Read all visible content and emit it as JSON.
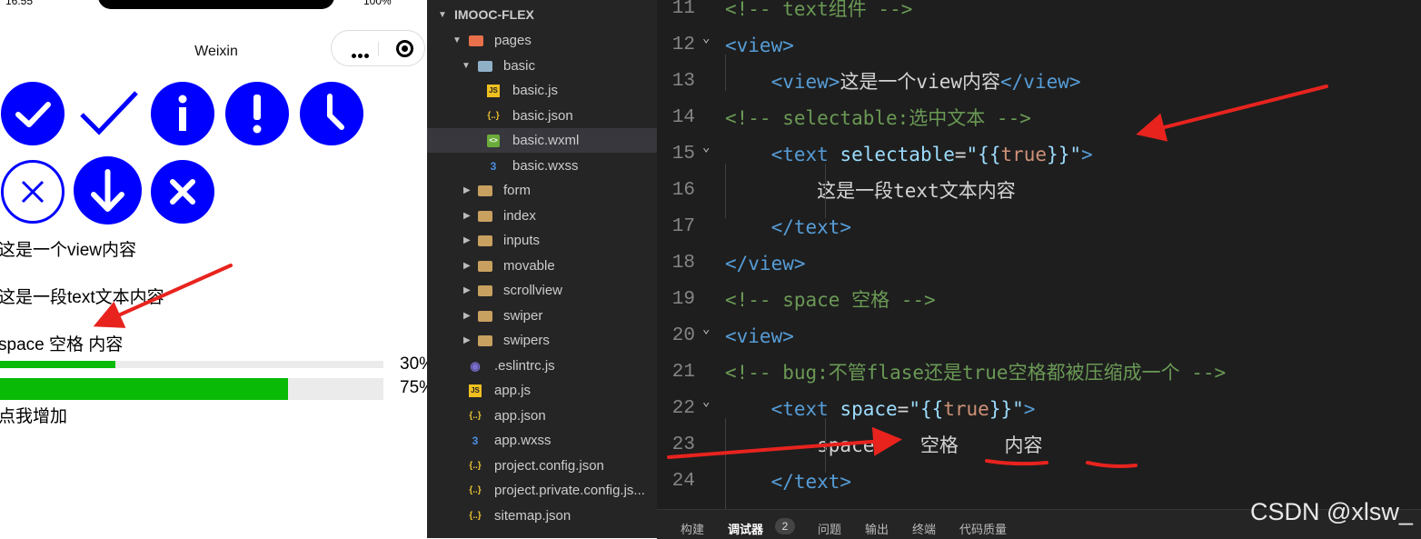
{
  "phone": {
    "status_time": "16:55",
    "status_battery": "100%",
    "nav_title": "Weixin",
    "view_text": "这是一个view内容",
    "selectable_text": "这是一段text文本内容",
    "space_text": "space 空格 内容",
    "progress": [
      {
        "value": 30,
        "label": "30%"
      },
      {
        "value": 75,
        "label": "75%"
      }
    ],
    "button_text": "点我增加",
    "icons": [
      "success-icon",
      "success-no-circle-icon",
      "info-icon",
      "warn-icon",
      "waiting-icon",
      "clear-icon",
      "download-icon",
      "cancel-icon"
    ],
    "colors": {
      "icon": "#0000ff",
      "progress_fill": "#09bb07"
    }
  },
  "explorer": {
    "project": "IMOOC-FLEX",
    "items": [
      {
        "label": "pages",
        "kind": "folder-open"
      },
      {
        "label": "basic",
        "kind": "folder-open"
      },
      {
        "label": "basic.js",
        "kind": "js"
      },
      {
        "label": "basic.json",
        "kind": "json"
      },
      {
        "label": "basic.wxml",
        "kind": "wxml",
        "active": true
      },
      {
        "label": "basic.wxss",
        "kind": "wxss"
      },
      {
        "label": "form",
        "kind": "folder"
      },
      {
        "label": "index",
        "kind": "folder"
      },
      {
        "label": "inputs",
        "kind": "folder"
      },
      {
        "label": "movable",
        "kind": "folder"
      },
      {
        "label": "scrollview",
        "kind": "folder"
      },
      {
        "label": "swiper",
        "kind": "folder"
      },
      {
        "label": "swipers",
        "kind": "folder"
      },
      {
        "label": ".eslintrc.js",
        "kind": "eslint"
      },
      {
        "label": "app.js",
        "kind": "js"
      },
      {
        "label": "app.json",
        "kind": "json"
      },
      {
        "label": "app.wxss",
        "kind": "wxss"
      },
      {
        "label": "project.config.json",
        "kind": "json"
      },
      {
        "label": "project.private.config.js...",
        "kind": "json"
      },
      {
        "label": "sitemap.json",
        "kind": "json"
      }
    ]
  },
  "editor": {
    "lines": [
      {
        "n": "11",
        "parts": [
          [
            "c-com",
            "<!-- text组件 -->"
          ]
        ]
      },
      {
        "n": "12",
        "parts": [
          [
            "c-tag",
            "<view>"
          ]
        ]
      },
      {
        "n": "13",
        "parts": [
          [
            "c-txt",
            "    "
          ],
          [
            "c-tag",
            "<view>"
          ],
          [
            "c-txt",
            "这是一个view内容"
          ],
          [
            "c-tag",
            "</view>"
          ]
        ]
      },
      {
        "n": "14",
        "parts": [
          [
            "c-com",
            "<!-- selectable:选中文本 -->"
          ]
        ]
      },
      {
        "n": "15",
        "parts": [
          [
            "c-txt",
            "    "
          ],
          [
            "c-tag",
            "<text "
          ],
          [
            "c-attr",
            "selectable"
          ],
          [
            "c-txt",
            "="
          ],
          [
            "c-attr",
            "\"{{"
          ],
          [
            "c-str",
            "true"
          ],
          [
            "c-attr",
            "}}\""
          ],
          [
            "c-tag",
            ">"
          ]
        ]
      },
      {
        "n": "16",
        "parts": [
          [
            "c-txt",
            "        这是一段text文本内容"
          ]
        ]
      },
      {
        "n": "17",
        "parts": [
          [
            "c-txt",
            "    "
          ],
          [
            "c-tag",
            "</text>"
          ]
        ]
      },
      {
        "n": "18",
        "parts": [
          [
            "c-tag",
            "</view>"
          ]
        ]
      },
      {
        "n": "19",
        "parts": [
          [
            "c-com",
            "<!-- space 空格 -->"
          ]
        ]
      },
      {
        "n": "20",
        "parts": [
          [
            "c-tag",
            "<view>"
          ]
        ]
      },
      {
        "n": "21",
        "parts": [
          [
            "c-com",
            "<!-- bug:不管flase还是true空格都被压缩成一个 -->"
          ]
        ]
      },
      {
        "n": "22",
        "parts": [
          [
            "c-txt",
            "    "
          ],
          [
            "c-tag",
            "<text "
          ],
          [
            "c-attr",
            "space"
          ],
          [
            "c-txt",
            "="
          ],
          [
            "c-attr",
            "\"{{"
          ],
          [
            "c-str",
            "true"
          ],
          [
            "c-attr",
            "}}\""
          ],
          [
            "c-tag",
            ">"
          ]
        ]
      },
      {
        "n": "23",
        "parts": [
          [
            "c-txt",
            "        space    空格    内容"
          ]
        ]
      },
      {
        "n": "24",
        "parts": [
          [
            "c-txt",
            "    "
          ],
          [
            "c-tag",
            "</text>"
          ]
        ]
      }
    ]
  },
  "panel": {
    "tabs": [
      "构建",
      "调试器",
      "问题",
      "输出",
      "终端",
      "代码质量"
    ],
    "active": "调试器",
    "badge": "2"
  },
  "watermark": "CSDN @xlsw_"
}
